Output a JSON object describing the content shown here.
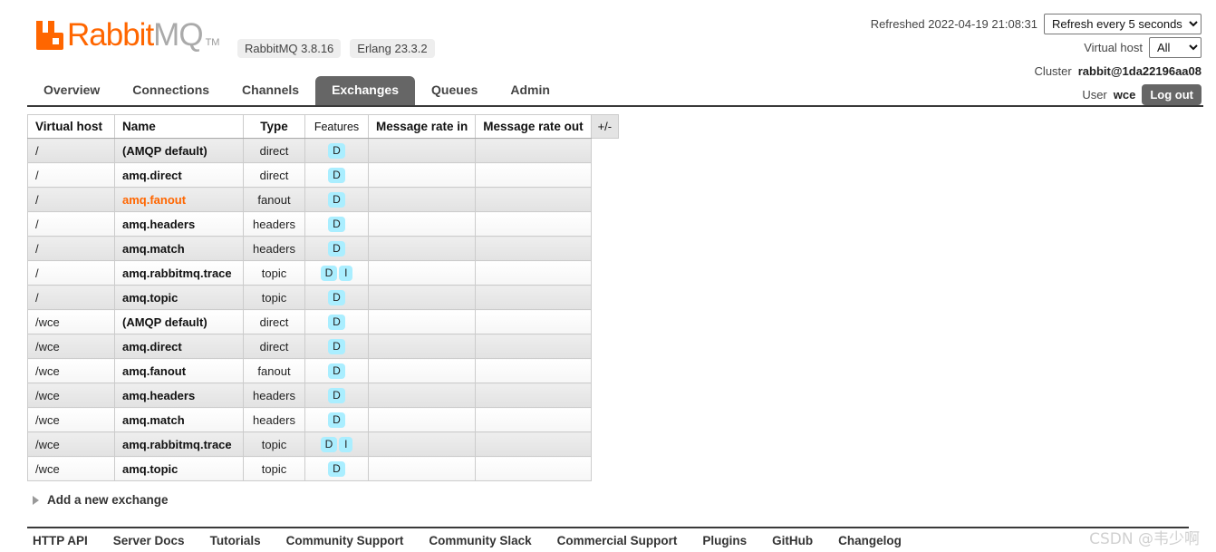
{
  "brand": {
    "logo_icon": "rabbitmq-logo-icon",
    "name_part1": "Rabbit",
    "name_part2": "MQ",
    "tm": "TM",
    "badges": [
      "RabbitMQ 3.8.16",
      "Erlang 23.3.2"
    ],
    "accent_color": "#ff6600"
  },
  "topright": {
    "refreshed_label": "Refreshed 2022-04-19 21:08:31",
    "refresh_select": "Refresh every 5 seconds",
    "refresh_options": [
      "Refresh every 5 seconds"
    ],
    "vhost_label": "Virtual host",
    "vhost_select": "All",
    "vhost_options": [
      "All"
    ],
    "cluster_label": "Cluster",
    "cluster_value": "rabbit@1da22196aa08",
    "user_label": "User",
    "user_value": "wce",
    "logout_label": "Log out"
  },
  "tabs": [
    {
      "label": "Overview",
      "active": false
    },
    {
      "label": "Connections",
      "active": false
    },
    {
      "label": "Channels",
      "active": false
    },
    {
      "label": "Exchanges",
      "active": true
    },
    {
      "label": "Queues",
      "active": false
    },
    {
      "label": "Admin",
      "active": false
    }
  ],
  "table": {
    "headers": {
      "vhost": "Virtual host",
      "name": "Name",
      "type": "Type",
      "features": "Features",
      "rate_in": "Message rate in",
      "rate_out": "Message rate out",
      "plusminus": "+/-"
    },
    "rows": [
      {
        "vhost": "/",
        "name": "(AMQP default)",
        "type": "direct",
        "features": [
          "D"
        ],
        "rate_in": "",
        "rate_out": "",
        "highlight": false
      },
      {
        "vhost": "/",
        "name": "amq.direct",
        "type": "direct",
        "features": [
          "D"
        ],
        "rate_in": "",
        "rate_out": "",
        "highlight": false
      },
      {
        "vhost": "/",
        "name": "amq.fanout",
        "type": "fanout",
        "features": [
          "D"
        ],
        "rate_in": "",
        "rate_out": "",
        "highlight": true
      },
      {
        "vhost": "/",
        "name": "amq.headers",
        "type": "headers",
        "features": [
          "D"
        ],
        "rate_in": "",
        "rate_out": "",
        "highlight": false
      },
      {
        "vhost": "/",
        "name": "amq.match",
        "type": "headers",
        "features": [
          "D"
        ],
        "rate_in": "",
        "rate_out": "",
        "highlight": false
      },
      {
        "vhost": "/",
        "name": "amq.rabbitmq.trace",
        "type": "topic",
        "features": [
          "D",
          "I"
        ],
        "rate_in": "",
        "rate_out": "",
        "highlight": false
      },
      {
        "vhost": "/",
        "name": "amq.topic",
        "type": "topic",
        "features": [
          "D"
        ],
        "rate_in": "",
        "rate_out": "",
        "highlight": false
      },
      {
        "vhost": "/wce",
        "name": "(AMQP default)",
        "type": "direct",
        "features": [
          "D"
        ],
        "rate_in": "",
        "rate_out": "",
        "highlight": false
      },
      {
        "vhost": "/wce",
        "name": "amq.direct",
        "type": "direct",
        "features": [
          "D"
        ],
        "rate_in": "",
        "rate_out": "",
        "highlight": false
      },
      {
        "vhost": "/wce",
        "name": "amq.fanout",
        "type": "fanout",
        "features": [
          "D"
        ],
        "rate_in": "",
        "rate_out": "",
        "highlight": false
      },
      {
        "vhost": "/wce",
        "name": "amq.headers",
        "type": "headers",
        "features": [
          "D"
        ],
        "rate_in": "",
        "rate_out": "",
        "highlight": false
      },
      {
        "vhost": "/wce",
        "name": "amq.match",
        "type": "headers",
        "features": [
          "D"
        ],
        "rate_in": "",
        "rate_out": "",
        "highlight": false
      },
      {
        "vhost": "/wce",
        "name": "amq.rabbitmq.trace",
        "type": "topic",
        "features": [
          "D",
          "I"
        ],
        "rate_in": "",
        "rate_out": "",
        "highlight": false
      },
      {
        "vhost": "/wce",
        "name": "amq.topic",
        "type": "topic",
        "features": [
          "D"
        ],
        "rate_in": "",
        "rate_out": "",
        "highlight": false
      }
    ]
  },
  "add_section": {
    "label": "Add a new exchange",
    "expander_icon": "triangle-right-icon"
  },
  "footer": {
    "links": [
      "HTTP API",
      "Server Docs",
      "Tutorials",
      "Community Support",
      "Community Slack",
      "Commercial Support",
      "Plugins",
      "GitHub",
      "Changelog"
    ]
  },
  "watermark": "CSDN @韦少啊"
}
